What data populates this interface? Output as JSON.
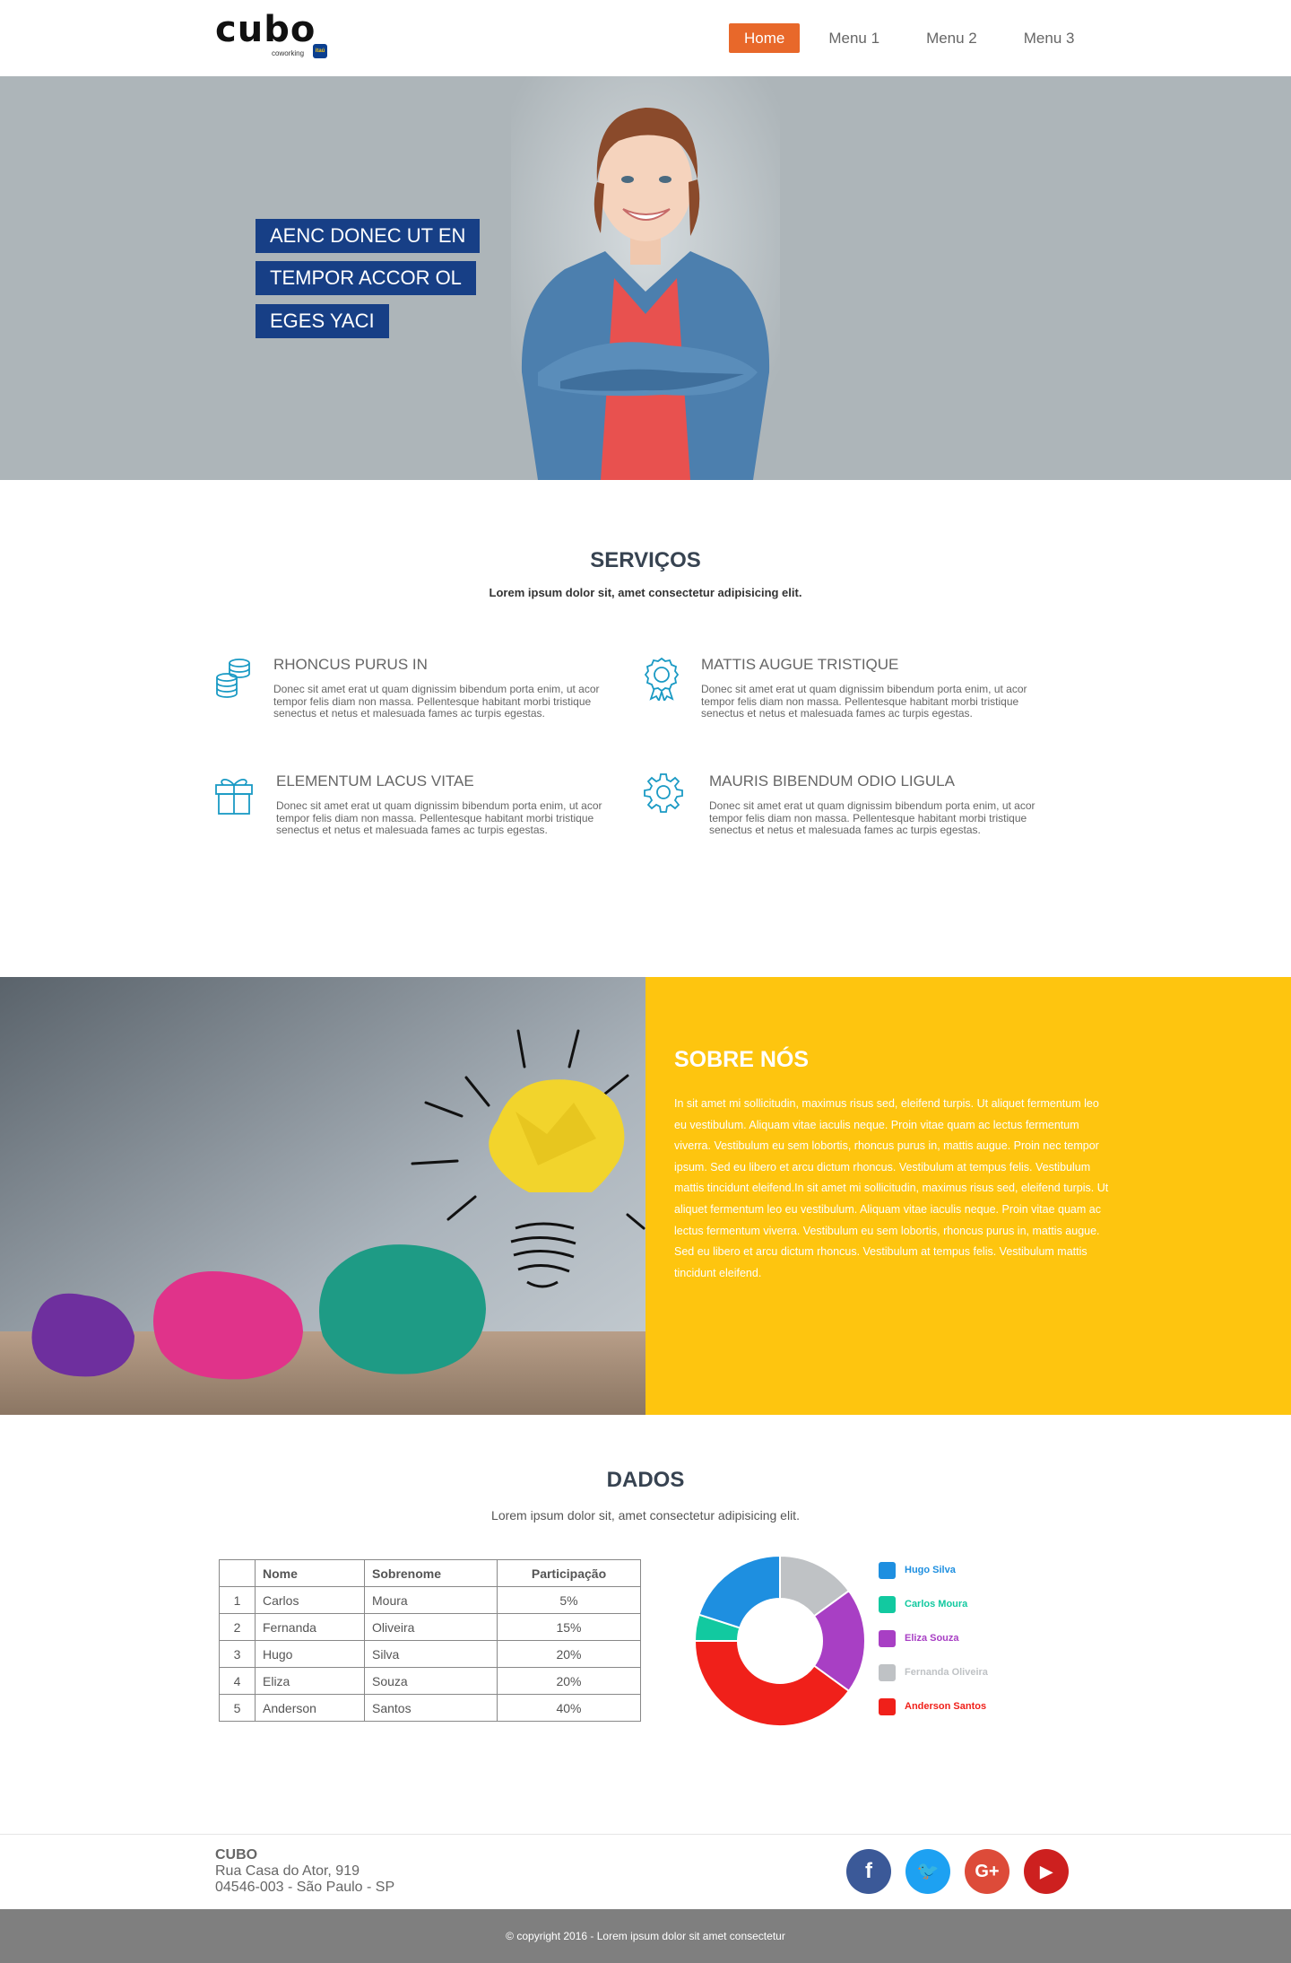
{
  "header": {
    "logo_text": "cubo",
    "logo_sub": "coworking",
    "logo_badge": "itaú",
    "nav": [
      {
        "label": "Home",
        "active": true
      },
      {
        "label": "Menu 1"
      },
      {
        "label": "Menu 2"
      },
      {
        "label": "Menu 3"
      }
    ]
  },
  "hero": {
    "lines": [
      "AENC DONEC UT EN",
      "TEMPOR ACCOR OL",
      "EGES YACI"
    ]
  },
  "services": {
    "title": "SERVIÇOS",
    "subtitle": "Lorem ipsum dolor sit, amet consectetur adipisicing elit.",
    "items": [
      {
        "icon": "coins-icon",
        "title": "RHONCUS PURUS IN",
        "text": "Donec sit amet erat ut quam dignissim bibendum porta enim, ut acor tempor felis diam non massa. Pellentesque habitant morbi tristique senectus et netus et malesuada fames ac turpis egestas."
      },
      {
        "icon": "award-icon",
        "title": "MATTIS AUGUE TRISTIQUE",
        "text": "Donec sit amet erat ut quam dignissim bibendum porta enim, ut acor tempor felis diam non massa. Pellentesque habitant morbi tristique senectus et netus et malesuada fames ac turpis egestas."
      },
      {
        "icon": "gift-icon",
        "title": "ELEMENTUM LACUS VITAE",
        "text": "Donec sit amet erat ut quam dignissim bibendum porta enim, ut acor tempor felis diam non massa. Pellentesque habitant morbi tristique senectus et netus et malesuada fames ac turpis egestas."
      },
      {
        "icon": "gear-icon",
        "title": "MAURIS BIBENDUM ODIO LIGULA",
        "text": "Donec sit amet erat ut quam dignissim bibendum porta enim, ut acor tempor felis diam non massa. Pellentesque habitant morbi tristique senectus et netus et malesuada fames ac turpis egestas."
      }
    ]
  },
  "about": {
    "title": "SOBRE NÓS",
    "text": "In sit amet mi sollicitudin, maximus risus sed, eleifend turpis. Ut aliquet fermentum leo eu vestibulum. Aliquam vitae iaculis neque. Proin vitae quam ac lectus fermentum viverra. Vestibulum eu sem lobortis, rhoncus purus in, mattis augue. Proin nec tempor ipsum. Sed eu libero et arcu dictum rhoncus. Vestibulum at tempus felis. Vestibulum mattis tincidunt eleifend.In sit amet mi sollicitudin, maximus risus sed, eleifend turpis. Ut aliquet fermentum leo eu vestibulum. Aliquam vitae iaculis neque. Proin vitae quam ac lectus fermentum viverra. Vestibulum eu sem lobortis, rhoncus purus in, mattis augue. Sed eu libero et arcu dictum rhoncus. Vestibulum at tempus felis. Vestibulum mattis tincidunt eleifend."
  },
  "dados": {
    "title": "DADOS",
    "subtitle": "Lorem ipsum dolor sit, amet consectetur adipisicing elit.",
    "table": {
      "headers": [
        "",
        "Nome",
        "Sobrenome",
        "Participação"
      ],
      "rows": [
        [
          "1",
          "Carlos",
          "Moura",
          "5%"
        ],
        [
          "2",
          "Fernanda",
          "Oliveira",
          "15%"
        ],
        [
          "3",
          "Hugo",
          "Silva",
          "20%"
        ],
        [
          "4",
          "Eliza",
          "Souza",
          "20%"
        ],
        [
          "5",
          "Anderson",
          "Santos",
          "40%"
        ]
      ]
    }
  },
  "chart_data": {
    "type": "pie",
    "donut": true,
    "categories": [
      "Hugo Silva",
      "Carlos Moura",
      "Eliza Souza",
      "Fernanda Oliveira",
      "Anderson Santos"
    ],
    "values": [
      20,
      5,
      20,
      15,
      40
    ],
    "colors": [
      "#1e8fe0",
      "#12c9a0",
      "#a83fc4",
      "#bfc2c5",
      "#f0201a"
    ],
    "legend_position": "right"
  },
  "footer": {
    "name": "CUBO",
    "address_line1": "Rua Casa do Ator, 919",
    "address_line2": "04546-003 - São Paulo - SP",
    "social": [
      {
        "icon": "facebook-icon",
        "glyph": "f",
        "color": "#3b5998"
      },
      {
        "icon": "twitter-icon",
        "glyph": "🐦",
        "color": "#1da1f2"
      },
      {
        "icon": "google-plus-icon",
        "glyph": "G+",
        "color": "#dd4b39"
      },
      {
        "icon": "youtube-icon",
        "glyph": "▶",
        "color": "#cd201f"
      }
    ],
    "copyright": "© copyright 2016 - Lorem ipsum dolor sit amet consectetur"
  }
}
